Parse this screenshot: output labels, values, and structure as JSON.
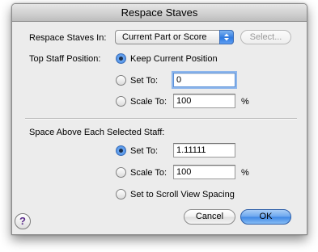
{
  "window": {
    "title": "Respace Staves"
  },
  "respace_in": {
    "label": "Respace Staves In:",
    "selected": "Current Part or Score",
    "select_button": "Select..."
  },
  "top_staff": {
    "label": "Top Staff Position:",
    "options": {
      "keep": "Keep Current Position",
      "set_to": "Set To:",
      "scale_to": "Scale To:"
    },
    "set_to_value": "0",
    "scale_to_value": "100",
    "percent": "%"
  },
  "space_above": {
    "label": "Space Above Each Selected Staff:",
    "options": {
      "set_to": "Set To:",
      "scale_to": "Scale To:",
      "scroll_view": "Set to Scroll View Spacing"
    },
    "set_to_value": "1.11111",
    "scale_to_value": "100",
    "percent": "%"
  },
  "buttons": {
    "help": "?",
    "cancel": "Cancel",
    "ok": "OK"
  }
}
